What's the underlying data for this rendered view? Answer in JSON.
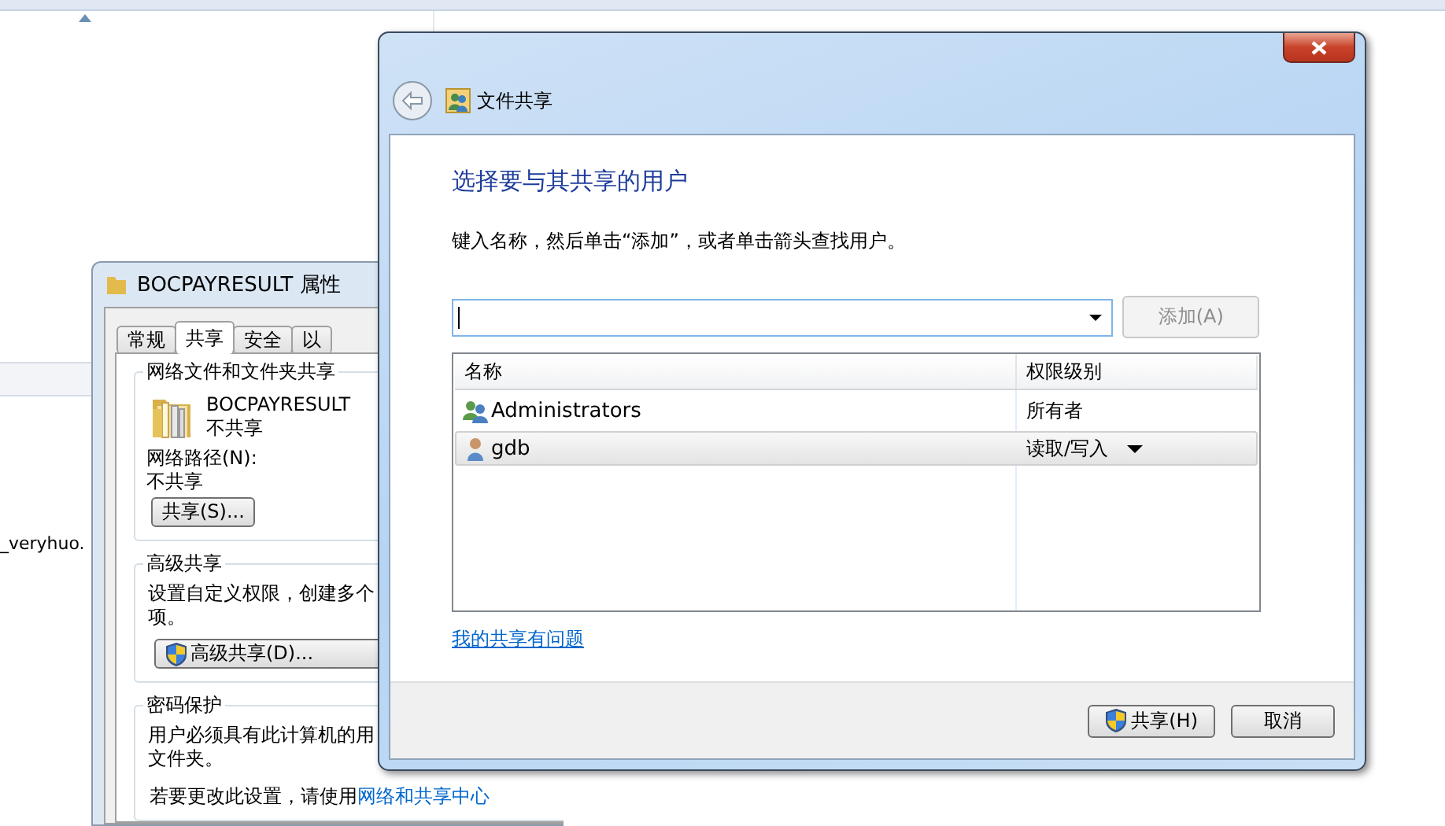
{
  "explorer": {
    "file_name_fragment": "_veryhuo."
  },
  "properties_dialog": {
    "title": "BOCPAYRESULT 属性",
    "tabs": [
      {
        "label": "常规",
        "selected": false
      },
      {
        "label": "共享",
        "selected": true
      },
      {
        "label": "安全",
        "selected": false
      },
      {
        "label": "以",
        "selected": false
      }
    ],
    "network_sharing": {
      "heading": "网络文件和文件夹共享",
      "folder_name": "BOCPAYRESULT",
      "status": "不共享",
      "path_label": "网络路径(N):",
      "path_value": "不共享",
      "share_button": "共享(S)..."
    },
    "advanced_sharing": {
      "heading": "高级共享",
      "description_lines": [
        "设置自定义权限，创建多个",
        "项。"
      ],
      "button": "高级共享(D)..."
    },
    "password_protection": {
      "heading": "密码保护",
      "description_lines": [
        "用户必须具有此计算机的用",
        "文件夹。"
      ],
      "note": "若要更改此设置，请使用",
      "note_link": "网络和共享中心"
    }
  },
  "sharing_dialog": {
    "title": "文件共享",
    "heading": "选择要与其共享的用户",
    "instruction": "键入名称，然后单击“添加”，或者单击箭头查找用户。",
    "add_button": {
      "label": "添加(A)",
      "disabled": true
    },
    "table": {
      "columns": [
        "名称",
        "权限级别"
      ],
      "rows": [
        {
          "name": "Administrators",
          "kind": "group",
          "permission": "所有者",
          "has_dropdown": false,
          "selected": false
        },
        {
          "name": "gdb",
          "kind": "user",
          "permission": "读取/写入",
          "has_dropdown": true,
          "selected": true
        }
      ]
    },
    "help_link": "我的共享有问题",
    "buttons": [
      {
        "label": "共享(H)",
        "shield": true
      },
      {
        "label": "取消",
        "shield": false
      }
    ]
  }
}
